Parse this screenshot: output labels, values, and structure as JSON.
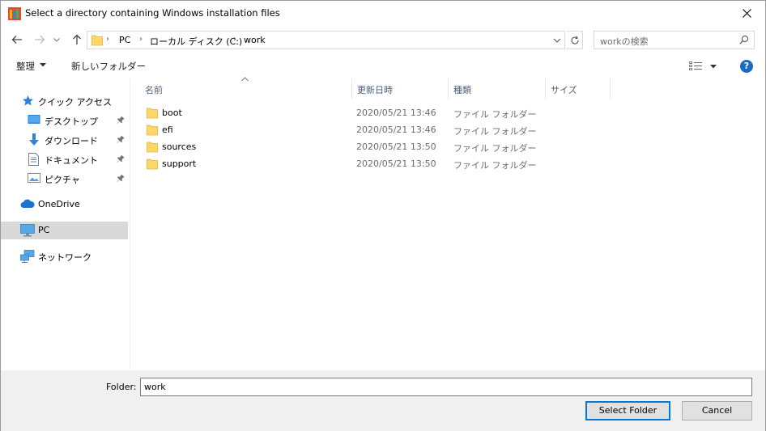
{
  "window": {
    "title": "Select a directory containing Windows installation files"
  },
  "nav": {
    "breadcrumbs": [
      "PC",
      "ローカル ディスク (C:)",
      "work"
    ],
    "search_placeholder": "workの検索"
  },
  "toolbar": {
    "organize_label": "整理",
    "new_folder_label": "新しいフォルダー"
  },
  "sidebar": {
    "quick_access": "クイック アクセス",
    "quick_items": [
      {
        "label": "デスクトップ",
        "icon": "desktop-icon"
      },
      {
        "label": "ダウンロード",
        "icon": "download-icon"
      },
      {
        "label": "ドキュメント",
        "icon": "documents-icon"
      },
      {
        "label": "ピクチャ",
        "icon": "pictures-icon"
      }
    ],
    "onedrive": "OneDrive",
    "pc": "PC",
    "network": "ネットワーク"
  },
  "columns": {
    "name": "名前",
    "date": "更新日時",
    "type": "種類",
    "size": "サイズ"
  },
  "files": [
    {
      "name": "boot",
      "date": "2020/05/21 13:46",
      "type": "ファイル フォルダー"
    },
    {
      "name": "efi",
      "date": "2020/05/21 13:46",
      "type": "ファイル フォルダー"
    },
    {
      "name": "sources",
      "date": "2020/05/21 13:50",
      "type": "ファイル フォルダー"
    },
    {
      "name": "support",
      "date": "2020/05/21 13:50",
      "type": "ファイル フォルダー"
    }
  ],
  "footer": {
    "folder_label": "Folder:",
    "folder_value": "work",
    "select_label": "Select Folder",
    "cancel_label": "Cancel"
  },
  "colors": {
    "accent": "#0078d7",
    "folder_yellow": "#ffd766",
    "selected_bg": "#d9d9d9"
  }
}
